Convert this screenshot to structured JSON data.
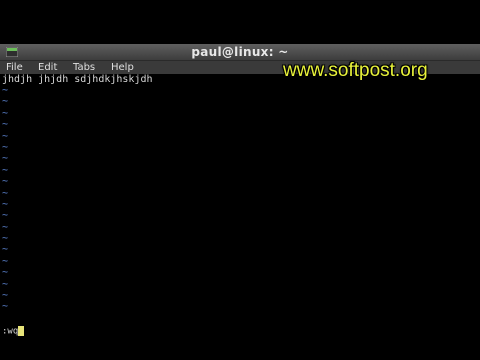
{
  "window": {
    "title": "paul@linux: ~"
  },
  "menu": {
    "items": [
      "File",
      "Edit",
      "Tabs",
      "Help"
    ]
  },
  "editor": {
    "text_line": "jhdjh jhjdh sdjhdkjhskjdh",
    "tilde": "~",
    "command": ":wq"
  },
  "watermark": "www.softpost.org",
  "colors": {
    "tilde": "#5f87d7",
    "cursor": "#e8e47a",
    "watermark": "#e8f23a",
    "titlebar": "#4a4a4a"
  },
  "icons": {
    "app": "terminal-app-icon"
  }
}
